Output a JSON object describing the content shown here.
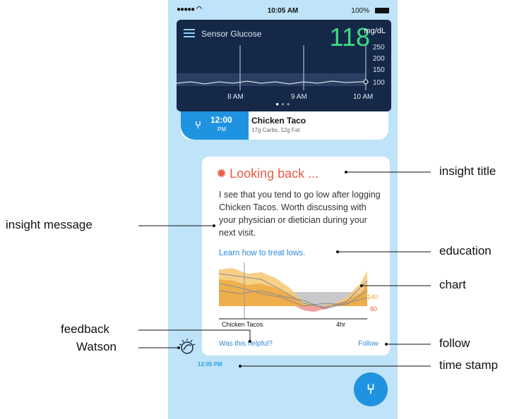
{
  "status_bar": {
    "signal": "●●●●●",
    "time": "10:05 AM",
    "battery": "100%"
  },
  "glucose": {
    "title": "Sensor Glucose",
    "value": "118",
    "unit": "mg/dL",
    "y_ticks": [
      "250",
      "200",
      "150",
      "100"
    ],
    "x_ticks": [
      "8 AM",
      "9 AM",
      "10 AM"
    ]
  },
  "meal": {
    "time": "12:00",
    "ampm": "PM",
    "name": "Chicken Taco",
    "info": "17g Carbs, 12g Fat"
  },
  "insight": {
    "title": "Looking back ...",
    "message": "I see that you tend to go low after logging Chicken Tacos. Worth discussing with your physician or dietician during your next visit.",
    "education": "Learn how to treat lows.",
    "chart": {
      "x_left": "Chicken Tacos",
      "x_right": "4hr",
      "line_high": "140",
      "line_low": "80"
    },
    "feedback": "Was this helpful?",
    "follow": "Follow"
  },
  "timestamp": "12:05 PM",
  "callouts": {
    "insight_title": "insight title",
    "insight_message": "insight message",
    "education": "education",
    "chart": "chart",
    "feedback": "feedback",
    "watson": "Watson",
    "follow": "follow",
    "time_stamp": "time stamp"
  },
  "colors": {
    "phone_bg": "#bfe3f8",
    "card_dark": "#152848",
    "glucose_green": "#3ddc84",
    "accent_blue": "#1f93e0",
    "insight_red": "#e85c48",
    "chart_orange": "#e8a530"
  }
}
